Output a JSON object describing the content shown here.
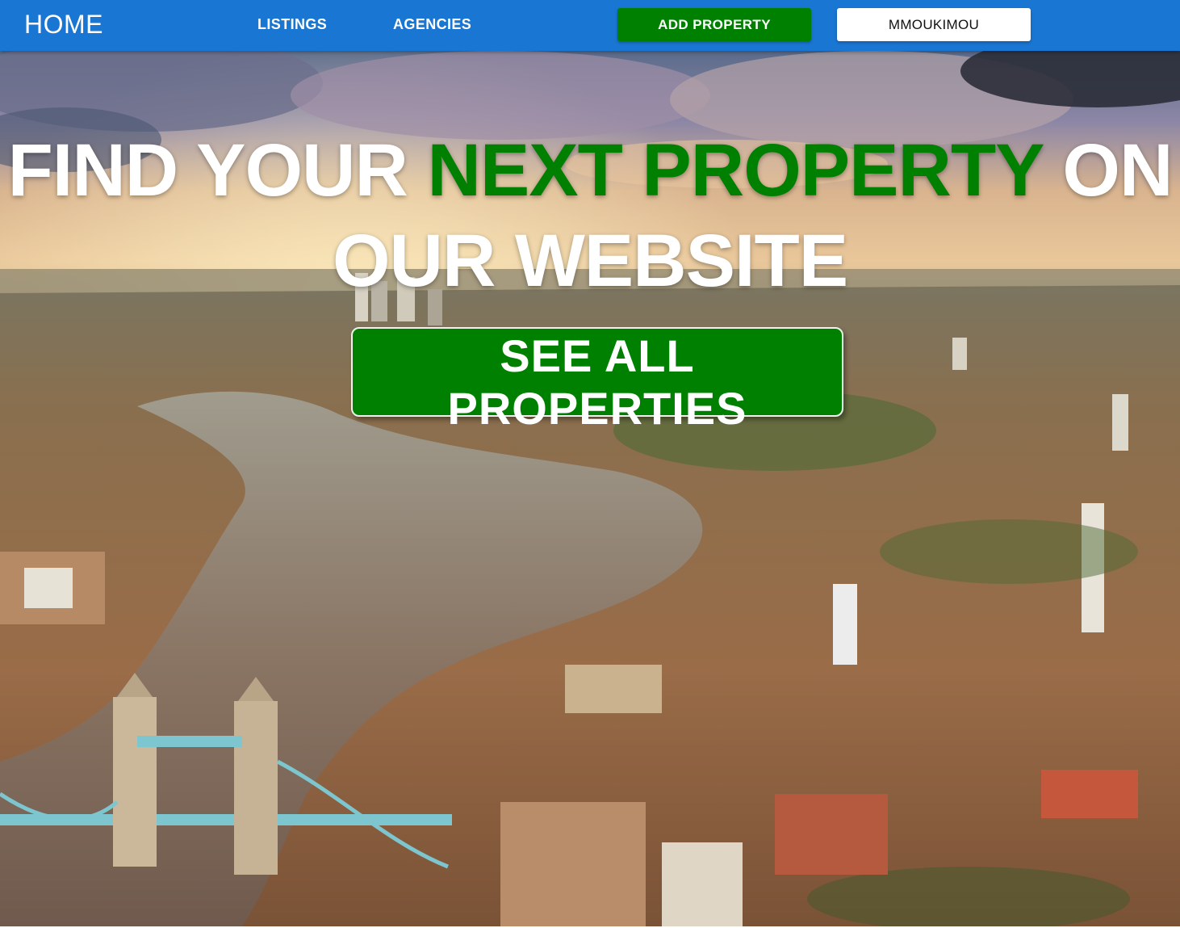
{
  "navbar": {
    "home_label": "HOME",
    "links": [
      {
        "label": "LISTINGS"
      },
      {
        "label": "AGENCIES"
      }
    ],
    "add_property_label": "ADD PROPERTY",
    "user_label": "MMOUKIMOU",
    "colors": {
      "bar": "#1976d2",
      "add_button": "#008000",
      "user_button": "#ffffff"
    }
  },
  "hero": {
    "title_part1": "FIND YOUR ",
    "title_accent": "NEXT PROPERTY",
    "title_part2": " ON OUR WEBSITE",
    "cta_label": "SEE ALL PROPERTIES",
    "accent_color": "#008000",
    "background": "aerial-city-river-photo"
  }
}
